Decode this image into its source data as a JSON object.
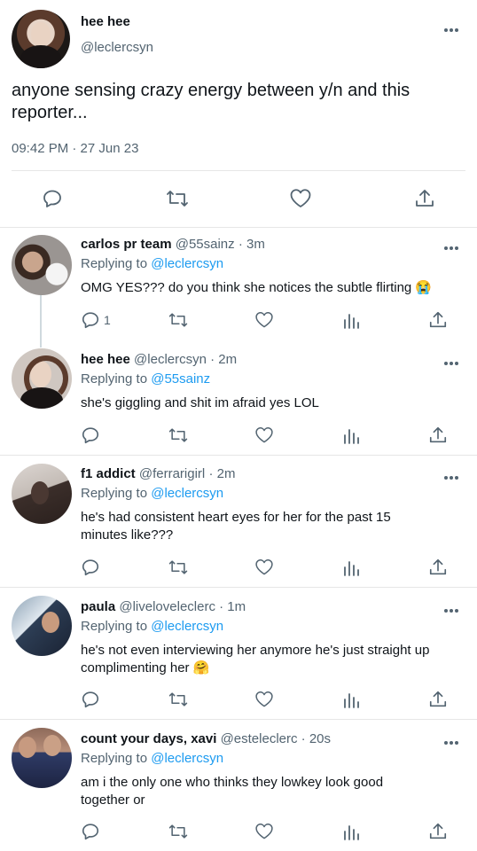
{
  "main_tweet": {
    "display_name": "hee hee",
    "handle": "@leclercsyn",
    "text": "anyone sensing crazy energy between y/n and this reporter...",
    "timestamp": "09:42 PM · 27 Jun 23",
    "more_icon": "more-dots-icon",
    "actions": [
      "reply-icon",
      "retweet-icon",
      "like-icon",
      "share-icon"
    ]
  },
  "replies": [
    {
      "display_name": "carlos pr team",
      "handle": "@55sainz",
      "time": "· 3m",
      "replying_label": "Replying to",
      "replying_to": "@leclercsyn",
      "text": "OMG YES??? do you think she notices the subtle flirting 😭",
      "reply_count": "1"
    },
    {
      "display_name": "hee hee",
      "handle": "@leclercsyn",
      "time": "· 2m",
      "replying_label": "Replying to",
      "replying_to": "@55sainz",
      "text": "she's giggling and shit im afraid yes LOL",
      "reply_count": ""
    },
    {
      "display_name": "f1 addict",
      "handle": "@ferrarigirl",
      "time": "· 2m",
      "replying_label": "Replying to",
      "replying_to": "@leclercsyn",
      "text": "he's had consistent heart eyes for her for the past 15 minutes like???",
      "reply_count": ""
    },
    {
      "display_name": "paula",
      "handle": "@liveloveleclerc",
      "time": "· 1m",
      "replying_label": "Replying to",
      "replying_to": "@leclercsyn",
      "text": "he's not even interviewing her anymore he's just straight up complimenting her 🤗",
      "reply_count": ""
    },
    {
      "display_name": "count your days, xavi",
      "handle": "@esteleclerc",
      "time": "· 20s",
      "replying_label": "Replying to",
      "replying_to": "@leclercsyn",
      "text": "am i the only one who thinks they lowkey look good together or",
      "reply_count": ""
    }
  ],
  "colors": {
    "link": "#1d9bf0",
    "secondary": "#536471",
    "text": "#0f1419",
    "separator": "#e6e6e6"
  }
}
